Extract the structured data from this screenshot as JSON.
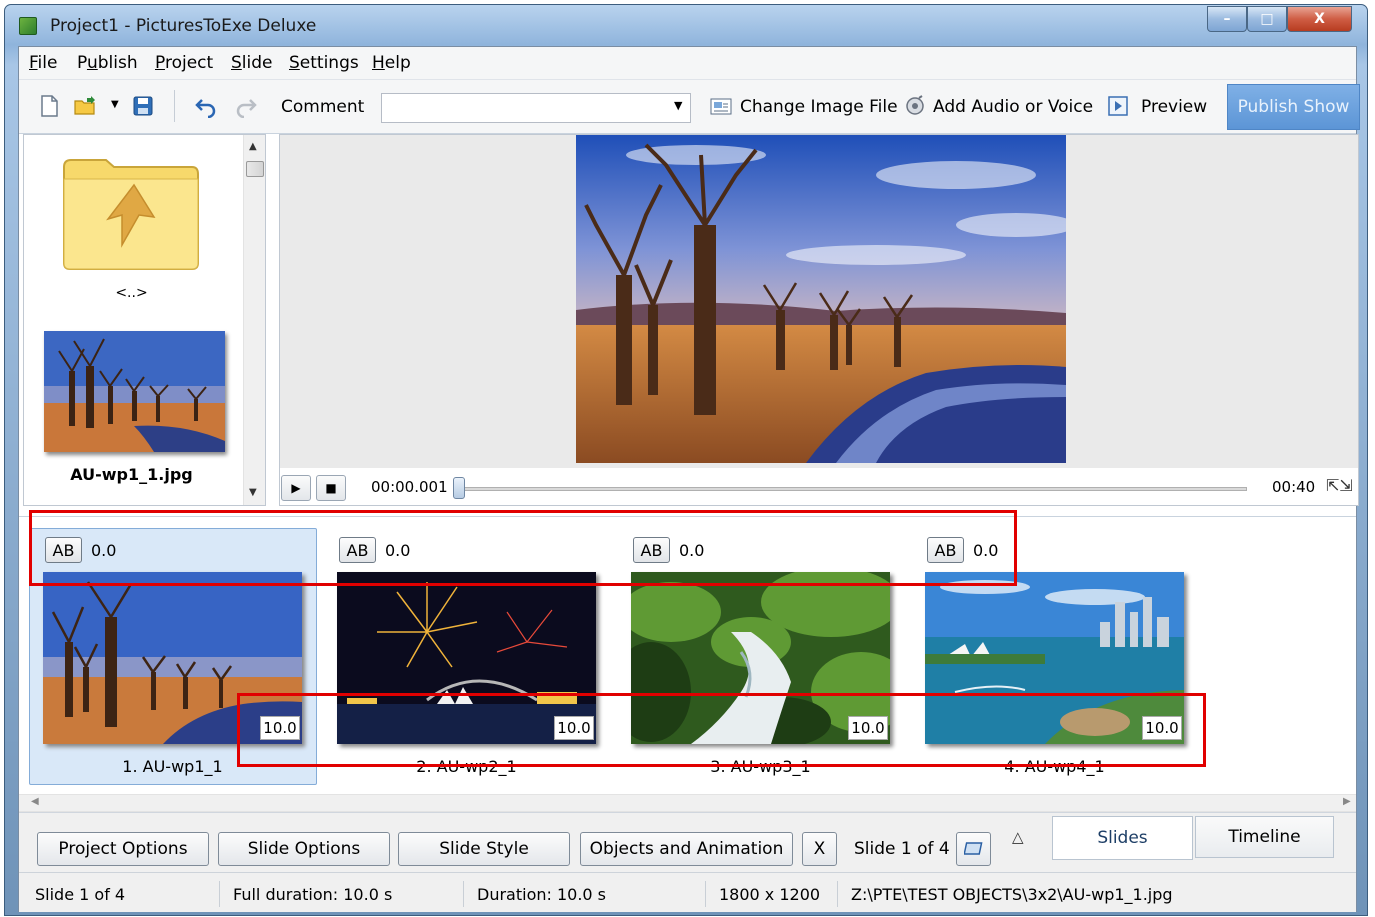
{
  "window": {
    "title": "Project1 - PicturesToExe Deluxe",
    "min_glyph": "–",
    "max_glyph": "□",
    "close_glyph": "X"
  },
  "menu": [
    {
      "label": "File"
    },
    {
      "label": "Publish"
    },
    {
      "label": "Project"
    },
    {
      "label": "Slide"
    },
    {
      "label": "Settings"
    },
    {
      "label": "Help"
    }
  ],
  "toolbar": {
    "comment_label": "Comment",
    "comment_value": "",
    "change_image_label": "Change Image File",
    "add_audio_label": "Add Audio or Voice",
    "preview_label": "Preview",
    "publish_label": "Publish Show"
  },
  "browser": {
    "folder_label": "<..>",
    "file_name": "AU-wp1_1.jpg"
  },
  "player": {
    "current_time": "00:00.001",
    "end_time": "00:40",
    "position": 0.0
  },
  "slides": [
    {
      "transition_label": "AB",
      "transition_value": "0.0",
      "duration": "10.0",
      "name": "1. AU-wp1_1",
      "selected": true
    },
    {
      "transition_label": "AB",
      "transition_value": "0.0",
      "duration": "10.0",
      "name": "2. AU-wp2_1",
      "selected": false
    },
    {
      "transition_label": "AB",
      "transition_value": "0.0",
      "duration": "10.0",
      "name": "3. AU-wp3_1",
      "selected": false
    },
    {
      "transition_label": "AB",
      "transition_value": "0.0",
      "duration": "10.0",
      "name": "4. AU-wp4_1",
      "selected": false
    }
  ],
  "buttons": {
    "project_options": "Project Options",
    "slide_options": "Slide Options",
    "slide_style": "Slide Style",
    "objects_animation": "Objects and Animation",
    "x": "X",
    "slide_counter": "Slide 1 of 4",
    "collapse_glyph": "△"
  },
  "tabs": {
    "slides": "Slides",
    "timeline": "Timeline"
  },
  "status": {
    "slide": "Slide 1 of 4",
    "full_duration": "Full duration: 10.0 s",
    "duration": "Duration: 10.0 s",
    "resolution": "1800 x 1200",
    "path": "Z:\\PTE\\TEST OBJECTS\\3x2\\AU-wp1_1.jpg"
  },
  "colors": {
    "accent": "#5c95d6",
    "selection": "#d9e8f8",
    "highlight_box": "#e10000"
  }
}
